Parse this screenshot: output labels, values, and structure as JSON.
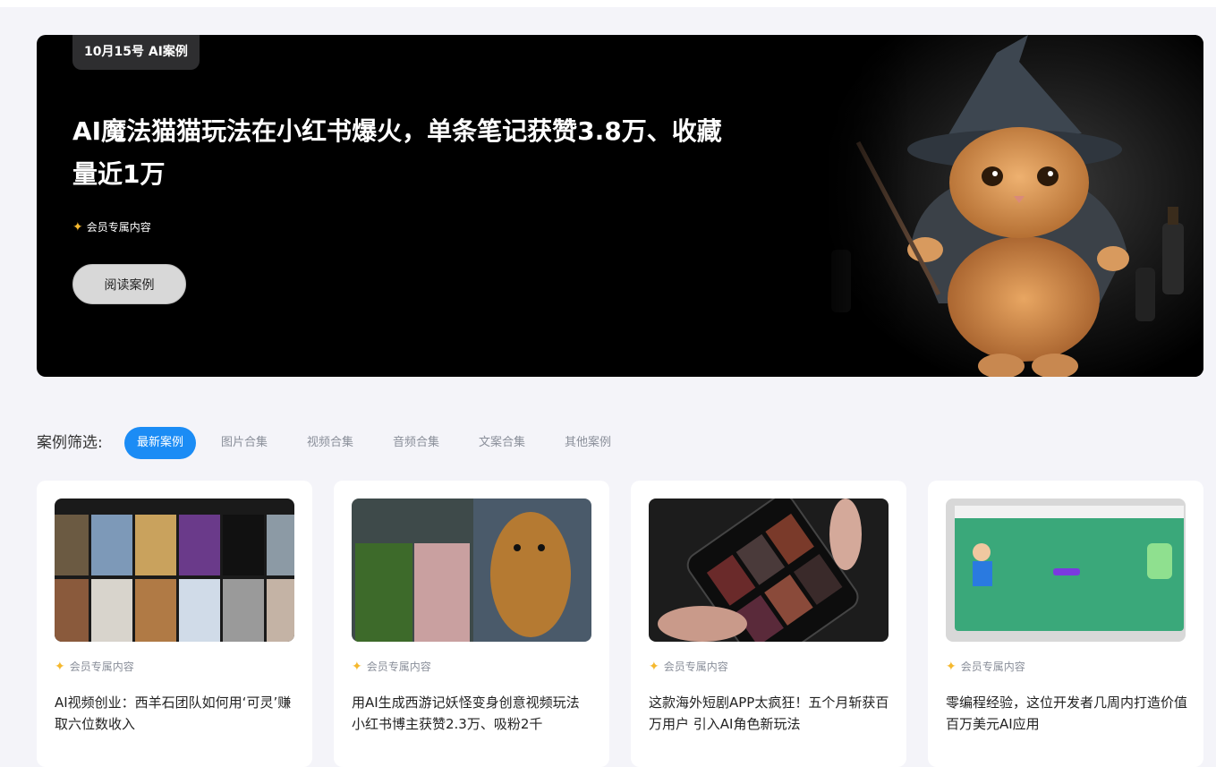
{
  "hero": {
    "date_tag": "10月15号 AI案例",
    "title_line1": "AI魔法猫猫玩法在小红书爆火，单条笔记获赞3.8万、收藏",
    "title_line2": "量近1万",
    "member_badge": "会员专属内容",
    "read_button": "阅读案例",
    "image_desc_icon": "wizard-cat-image"
  },
  "filter": {
    "label": "案例筛选:",
    "tabs": [
      {
        "label": "最新案例",
        "active": true
      },
      {
        "label": "图片合集",
        "active": false
      },
      {
        "label": "视频合集",
        "active": false
      },
      {
        "label": "音频合集",
        "active": false
      },
      {
        "label": "文案合集",
        "active": false
      },
      {
        "label": "其他案例",
        "active": false
      }
    ]
  },
  "cards": [
    {
      "badge": "会员专属内容",
      "title": "AI视频创业：西羊石团队如何用‘可灵’赚取六位数收入"
    },
    {
      "badge": "会员专属内容",
      "title": "用AI生成西游记妖怪变身创意视频玩法 小红书博主获赞2.3万、吸粉2千"
    },
    {
      "badge": "会员专属内容",
      "title": "这款海外短剧APP太疯狂！五个月斩获百万用户 引入AI角色新玩法"
    },
    {
      "badge": "会员专属内容",
      "title": "零编程经验，这位开发者几周内打造价值百万美元AI应用"
    }
  ],
  "colors": {
    "accent": "#1b8cf5",
    "star": "#f5b82e",
    "page_bg": "#f4f4f9",
    "hero_bg": "#000000"
  }
}
